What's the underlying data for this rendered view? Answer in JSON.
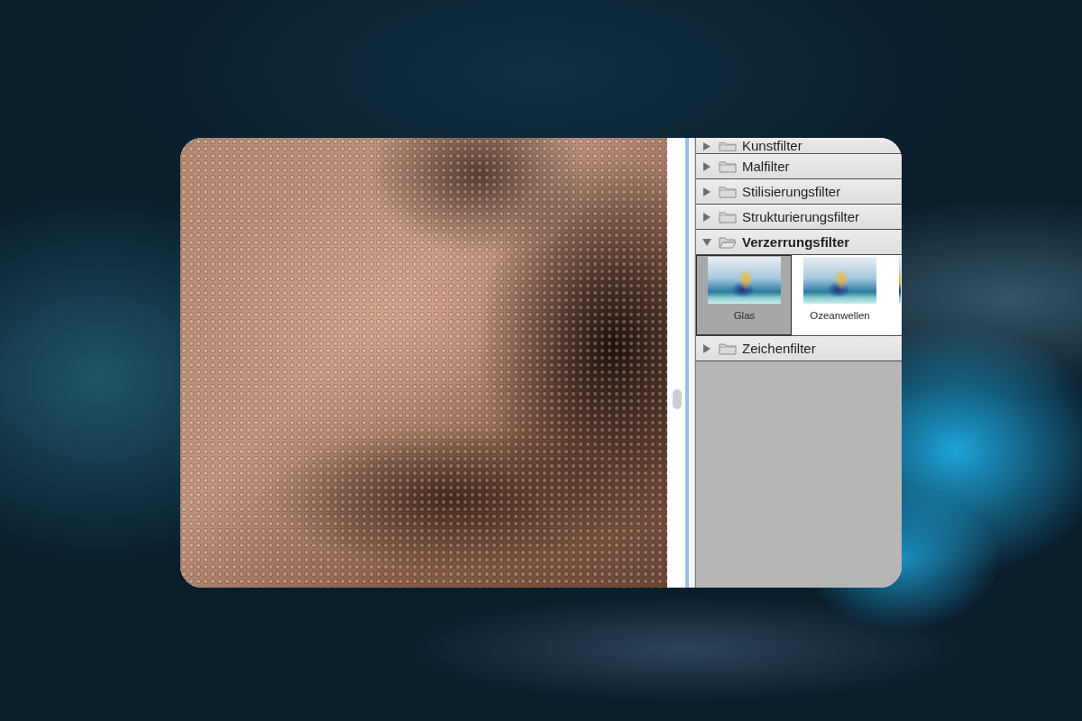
{
  "gallery": {
    "categories": [
      {
        "label": "Kunstfilter",
        "expanded": false
      },
      {
        "label": "Malfilter",
        "expanded": false
      },
      {
        "label": "Stilisierungsfilter",
        "expanded": false
      },
      {
        "label": "Strukturierungsfilter",
        "expanded": false
      },
      {
        "label": "Verzerrungsfilter",
        "expanded": true,
        "filters": [
          {
            "label": "Glas",
            "selected": true
          },
          {
            "label": "Ozeanwellen",
            "selected": false
          },
          {
            "selected": false
          }
        ]
      },
      {
        "label": "Zeichenfilter",
        "expanded": false
      }
    ]
  }
}
